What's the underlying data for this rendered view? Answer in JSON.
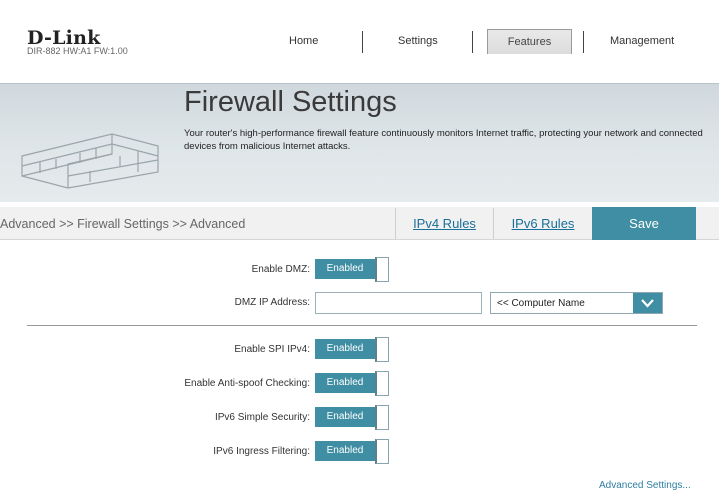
{
  "header": {
    "brand": "D-Link",
    "model": "DIR-882 HW:A1 FW:1.00",
    "nav": {
      "home": "Home",
      "settings": "Settings",
      "features": "Features",
      "management": "Management"
    }
  },
  "banner": {
    "title": "Firewall Settings",
    "description": "Your router's high-performance firewall feature continuously monitors Internet traffic, protecting your network and connected devices from malicious Internet attacks."
  },
  "toolbar": {
    "breadcrumb": "Advanced >> Firewall Settings >> Advanced",
    "ipv4_rules": "IPv4 Rules",
    "ipv6_rules": "IPv6 Rules",
    "save": "Save"
  },
  "form": {
    "dmz": {
      "label": "Enable DMZ:",
      "state": "Enabled"
    },
    "dmz_ip": {
      "label": "DMZ IP Address:",
      "value": "",
      "select_value": "<< Computer Name"
    },
    "spi": {
      "label": "Enable SPI IPv4:",
      "state": "Enabled"
    },
    "antispoof": {
      "label": "Enable Anti-spoof Checking:",
      "state": "Enabled"
    },
    "ipv6_simple": {
      "label": "IPv6 Simple Security:",
      "state": "Enabled"
    },
    "ipv6_ingress": {
      "label": "IPv6 Ingress Filtering:",
      "state": "Enabled"
    },
    "advanced_link": "Advanced Settings..."
  },
  "colors": {
    "accent": "#3f8ea3",
    "link": "#1a6f98"
  },
  "icons": {
    "wall": "brick-wall-icon",
    "dropdown": "chevron-down-icon"
  }
}
